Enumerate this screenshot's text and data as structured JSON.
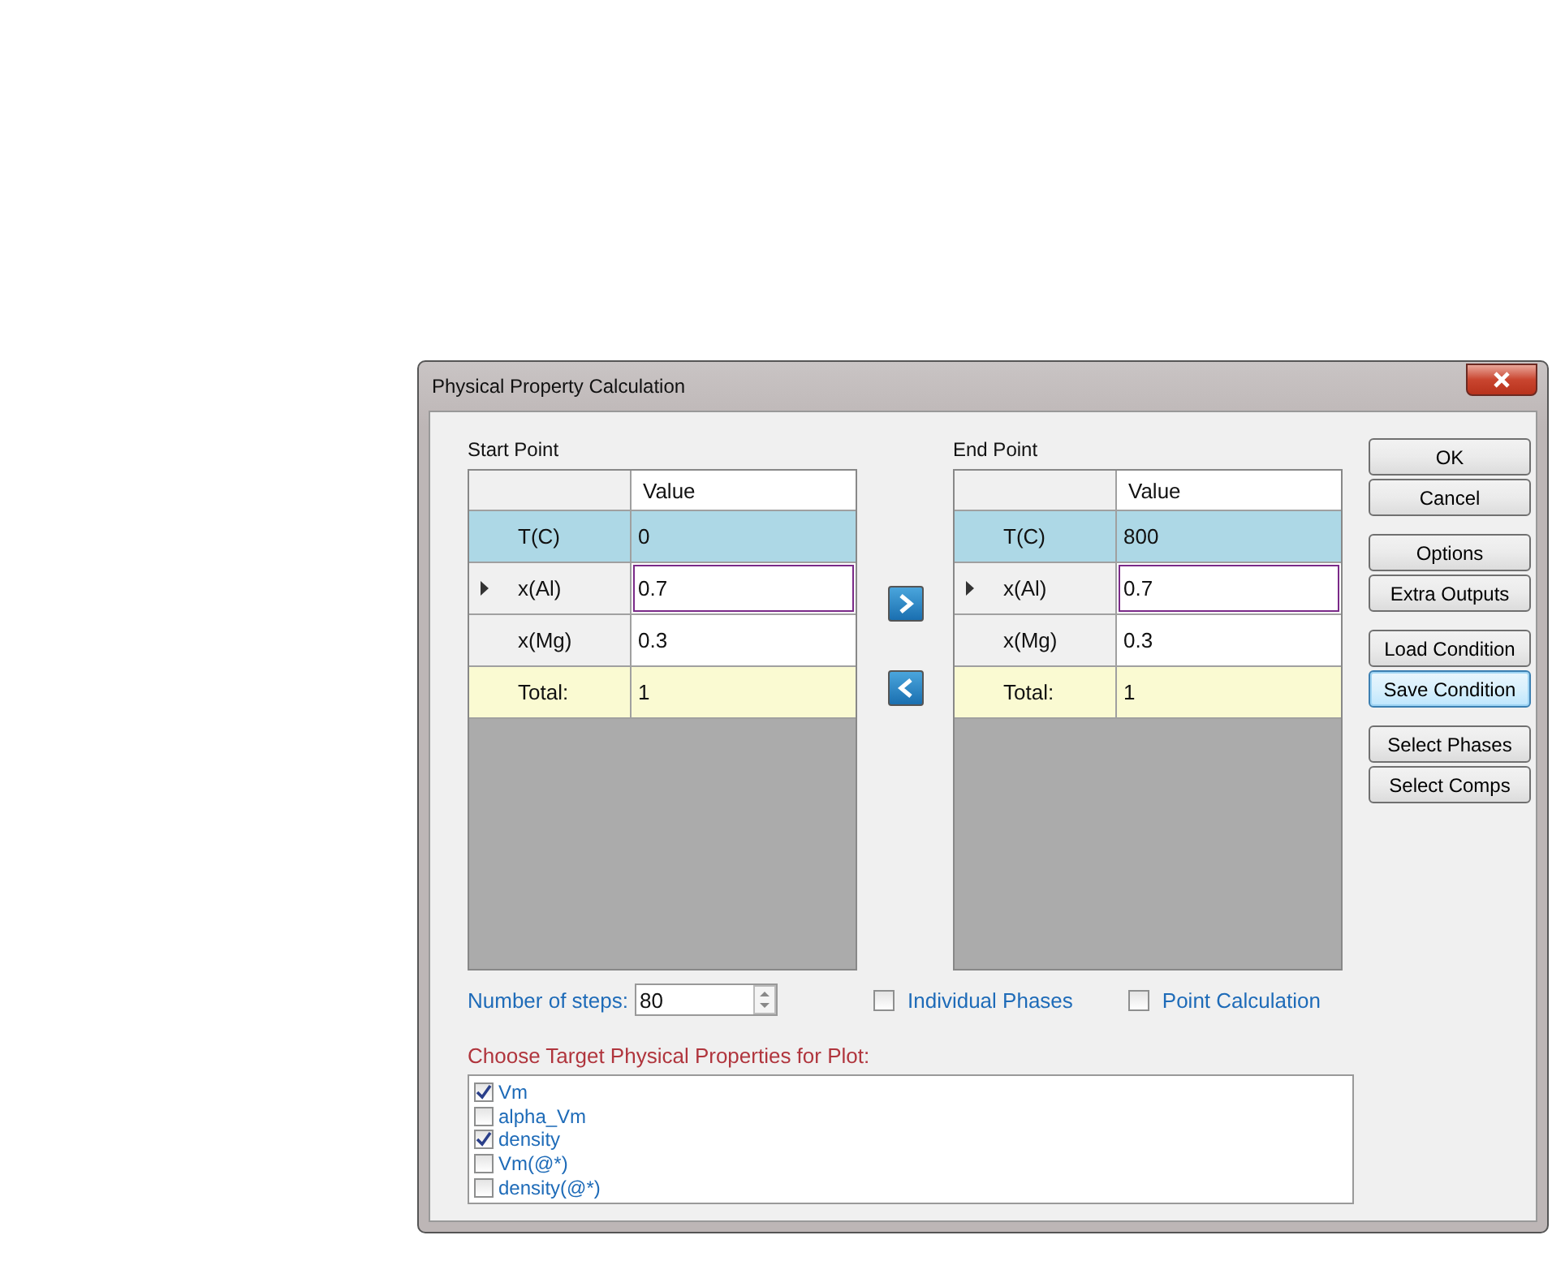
{
  "window": {
    "title": "Physical Property Calculation"
  },
  "grids": [
    {
      "title": "Start Point",
      "column": "Value",
      "rows": [
        {
          "label": "T(C)",
          "value": "0",
          "kind": "temperature",
          "selected": false
        },
        {
          "label": "x(Al)",
          "value": "0.7",
          "kind": "composition",
          "selected": true
        },
        {
          "label": "x(Mg)",
          "value": "0.3",
          "kind": "composition",
          "selected": false
        },
        {
          "label": "Total:",
          "value": "1",
          "kind": "total",
          "selected": false
        }
      ]
    },
    {
      "title": "End Point",
      "column": "Value",
      "rows": [
        {
          "label": "T(C)",
          "value": "800",
          "kind": "temperature",
          "selected": false
        },
        {
          "label": "x(Al)",
          "value": "0.7",
          "kind": "composition",
          "selected": true
        },
        {
          "label": "x(Mg)",
          "value": "0.3",
          "kind": "composition",
          "selected": false
        },
        {
          "label": "Total:",
          "value": "1",
          "kind": "total",
          "selected": false
        }
      ]
    }
  ],
  "buttons": [
    {
      "label": "OK",
      "focused": false
    },
    {
      "label": "Cancel",
      "focused": false
    },
    {
      "label": "Options",
      "focused": false
    },
    {
      "label": "Extra Outputs",
      "focused": false
    },
    {
      "label": "Load Condition",
      "focused": false
    },
    {
      "label": "Save Condition",
      "focused": true
    },
    {
      "label": "Select Phases",
      "focused": false
    },
    {
      "label": "Select Comps",
      "focused": false
    }
  ],
  "steps": {
    "label": "Number of steps:",
    "value": "80"
  },
  "options": [
    {
      "label": "Individual Phases",
      "checked": false
    },
    {
      "label": "Point Calculation",
      "checked": false
    }
  ],
  "properties": {
    "title": "Choose Target Physical Properties for Plot:",
    "items": [
      {
        "label": "Vm",
        "checked": true
      },
      {
        "label": "alpha_Vm",
        "checked": false
      },
      {
        "label": "density",
        "checked": true
      },
      {
        "label": "Vm(@*)",
        "checked": false
      },
      {
        "label": "density(@*)",
        "checked": false
      }
    ]
  }
}
